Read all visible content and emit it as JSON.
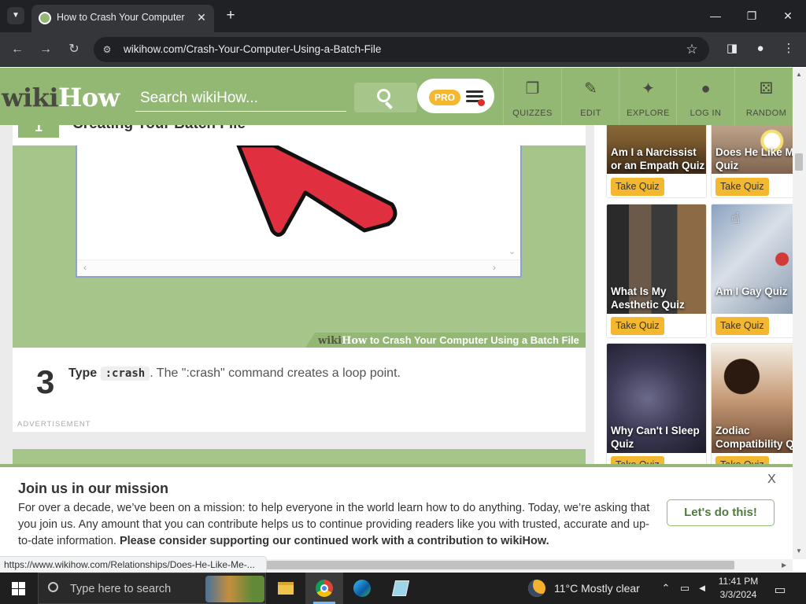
{
  "browser": {
    "tab_title": "How to Crash Your Computer U",
    "url": "wikihow.com/Crash-Your-Computer-Using-a-Batch-File",
    "status_url": "https://www.wikihow.com/Relationships/Does-He-Like-Me-..."
  },
  "header": {
    "logo_part1": "wiki",
    "logo_part2": "How",
    "search_placeholder": "Search wikiHow...",
    "pro_label": "PRO",
    "nav": [
      {
        "label": "QUIZZES",
        "icon": "quizzes-icon"
      },
      {
        "label": "EDIT",
        "icon": "pencil-icon"
      },
      {
        "label": "EXPLORE",
        "icon": "compass-icon"
      },
      {
        "label": "LOG IN",
        "icon": "user-icon"
      },
      {
        "label": "RANDOM",
        "icon": "dice-icon"
      }
    ]
  },
  "article": {
    "step1_number": "1",
    "step1_title": "Creating Your Batch File",
    "caption_prefix_1": "wiki",
    "caption_prefix_2": "How",
    "caption_text": " to Crash Your Computer Using a Batch File",
    "step3_number": "3",
    "step3_bold": "Type",
    "step3_code": ":crash",
    "step3_rest": ". The \":crash\" command creates a loop point.",
    "advertisement_label": "ADVERTISEMENT"
  },
  "sidebar": {
    "quizzes": [
      {
        "title": "Am I a Narcissist or an Empath Quiz",
        "button": "Take Quiz"
      },
      {
        "title": "Does He Like Me Quiz",
        "button": "Take Quiz"
      },
      {
        "title": "What Is My Aesthetic Quiz",
        "button": "Take Quiz"
      },
      {
        "title": "Am I Gay Quiz",
        "button": "Take Quiz"
      },
      {
        "title": "Why Can't I Sleep Quiz",
        "button": "Take Quiz"
      },
      {
        "title": "Zodiac Compatibility Quiz",
        "button": "Take Quiz"
      }
    ]
  },
  "banner": {
    "title": "Join us in our mission",
    "body": "For over a decade, we’ve been on a mission: to help everyone in the world learn how to do anything. Today, we’re asking that you join us. Any amount that you can contribute helps us to continue providing readers like you with trusted, accurate and up-to-date information. ",
    "body_bold": "Please consider supporting our continued work with a contribution to wikiHow.",
    "cta": "Let's do this!",
    "close": "X"
  },
  "taskbar": {
    "search_placeholder": "Type here to search",
    "temperature": "11°C",
    "weather": "Mostly clear",
    "time": "11:41 PM",
    "date": "3/3/2024"
  },
  "colors": {
    "brand_green": "#93b874",
    "quiz_button": "#f3b730",
    "arrow_red": "#e0303f"
  }
}
